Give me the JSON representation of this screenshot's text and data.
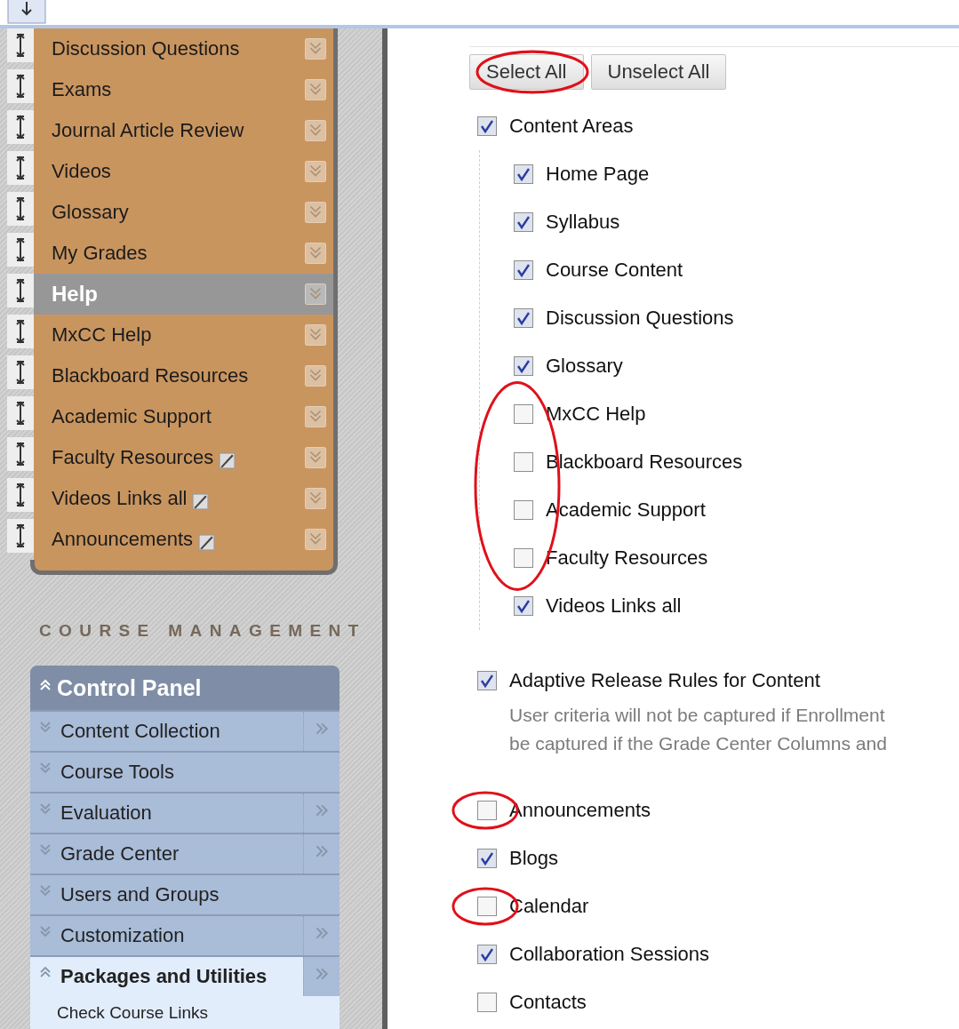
{
  "course_menu": {
    "items": [
      {
        "label": "Discussion Questions",
        "kind": "link",
        "hidden": false
      },
      {
        "label": "Exams",
        "kind": "link",
        "hidden": false
      },
      {
        "label": "Journal Article Review",
        "kind": "link",
        "hidden": false
      },
      {
        "label": "Videos",
        "kind": "link",
        "hidden": false
      },
      {
        "label": "Glossary",
        "kind": "link",
        "hidden": false
      },
      {
        "label": "My Grades",
        "kind": "link",
        "hidden": false
      },
      {
        "label": "Help",
        "kind": "subheader",
        "hidden": false
      },
      {
        "label": "MxCC Help",
        "kind": "link",
        "hidden": false
      },
      {
        "label": "Blackboard Resources",
        "kind": "link",
        "hidden": false
      },
      {
        "label": "Academic Support",
        "kind": "link",
        "hidden": false
      },
      {
        "label": "Faculty Resources",
        "kind": "link",
        "hidden": true
      },
      {
        "label": "Videos Links all",
        "kind": "link",
        "hidden": true
      },
      {
        "label": "Announcements",
        "kind": "link",
        "hidden": true
      }
    ]
  },
  "course_management": {
    "heading": "COURSE MANAGEMENT",
    "control_panel": {
      "title": "Control Panel",
      "expanded": true,
      "items": [
        {
          "label": "Content Collection",
          "expanded": false,
          "flyout": true
        },
        {
          "label": "Course Tools",
          "expanded": false,
          "flyout": false
        },
        {
          "label": "Evaluation",
          "expanded": false,
          "flyout": true
        },
        {
          "label": "Grade Center",
          "expanded": false,
          "flyout": true
        },
        {
          "label": "Users and Groups",
          "expanded": false,
          "flyout": false
        },
        {
          "label": "Customization",
          "expanded": false,
          "flyout": true
        },
        {
          "label": "Packages and Utilities",
          "expanded": true,
          "flyout": true,
          "children": [
            {
              "label": "Check Course Links"
            }
          ]
        }
      ]
    }
  },
  "buttons": [
    {
      "label": "Select All",
      "circled": true
    },
    {
      "label": "Unselect All",
      "circled": false
    }
  ],
  "options": [
    {
      "label": "Content Areas",
      "checked": true,
      "circled": false,
      "children": [
        {
          "label": "Home Page",
          "checked": true,
          "circled": false
        },
        {
          "label": "Syllabus",
          "checked": true,
          "circled": false
        },
        {
          "label": "Course Content",
          "checked": true,
          "circled": false
        },
        {
          "label": "Discussion Questions",
          "checked": true,
          "circled": false
        },
        {
          "label": "Glossary",
          "checked": true,
          "circled": false
        },
        {
          "label": "MxCC Help",
          "checked": false,
          "circled": true
        },
        {
          "label": "Blackboard Resources",
          "checked": false,
          "circled": true
        },
        {
          "label": "Academic Support",
          "checked": false,
          "circled": true
        },
        {
          "label": "Faculty Resources",
          "checked": false,
          "circled": true
        },
        {
          "label": "Videos Links all",
          "checked": true,
          "circled": false
        }
      ]
    },
    {
      "label": "Adaptive Release Rules for Content",
      "checked": true,
      "circled": false,
      "description": [
        "User criteria will not be captured if Enrollment",
        "be captured if the Grade Center Columns and"
      ]
    },
    {
      "label": "Announcements",
      "checked": false,
      "circled": true
    },
    {
      "label": "Blogs",
      "checked": true,
      "circled": false
    },
    {
      "label": "Calendar",
      "checked": false,
      "circled": true
    },
    {
      "label": "Collaboration Sessions",
      "checked": true,
      "circled": false
    },
    {
      "label": "Contacts",
      "checked": false,
      "circled": false
    }
  ]
}
